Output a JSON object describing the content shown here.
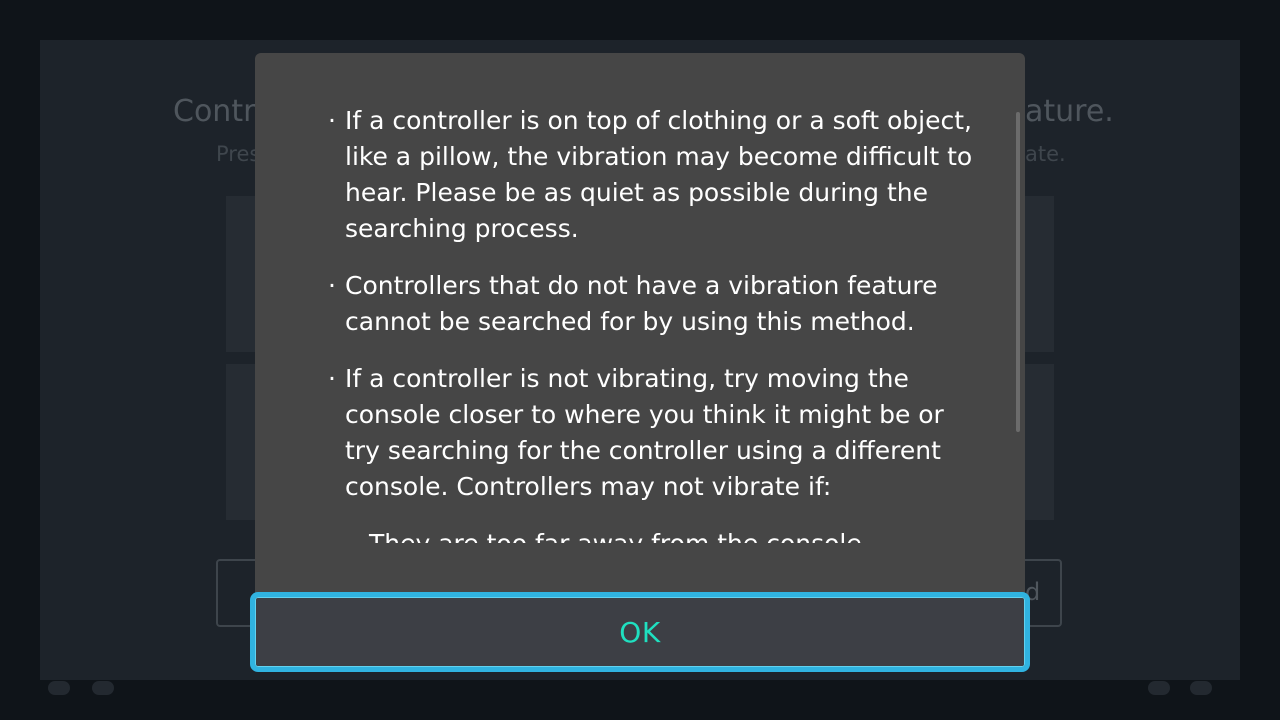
{
  "background": {
    "title_left": "Contr",
    "title_right": "ature.",
    "subtitle_left": "Pres",
    "subtitle_right": "ate.",
    "button_right": "d"
  },
  "dialog": {
    "bullets": [
      {
        "text": "If a controller is on top of clothing or a soft object, like a pillow, the vibration may become difficult to hear. Please be as quiet as possible during the searching process."
      },
      {
        "text": "Controllers that do not have a vibration feature cannot be searched for by using this method."
      },
      {
        "text": "If a controller is not vibrating, try moving the console closer to where you think it might be or try searching for the controller using a different console. Controllers may not vibrate if:"
      }
    ],
    "sub_bullet": "They are too far away from the console.",
    "ok_label": "OK"
  },
  "colors": {
    "accent_border": "#30b3e0",
    "ok_text": "#1fe0c0",
    "dialog_bg": "#464646"
  }
}
